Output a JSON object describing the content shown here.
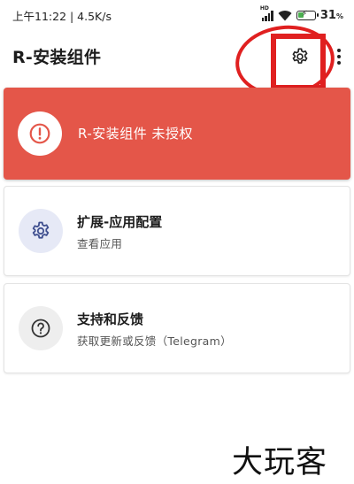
{
  "status_bar": {
    "time_speed": "上午11:22 | 4.5K/s",
    "network_badge": "HD",
    "battery": "31",
    "battery_unit": "%"
  },
  "app_bar": {
    "title": "R-安装组件",
    "settings_icon": "gear-icon",
    "menu_icon": "more-vert-icon"
  },
  "cards": {
    "alert": {
      "label": "R-安装组件 未授权",
      "icon": "alert-circle-icon",
      "color": "#e45649"
    },
    "config": {
      "title": "扩展-应用配置",
      "subtitle": "查看应用",
      "icon": "gear-icon",
      "icon_color": "#3f4f8f"
    },
    "feedback": {
      "title": "支持和反馈",
      "subtitle": "获取更新或反馈（Telegram）",
      "icon": "help-circle-icon"
    }
  },
  "annotation": {
    "color": "#e02020"
  },
  "watermark": "大玩客"
}
